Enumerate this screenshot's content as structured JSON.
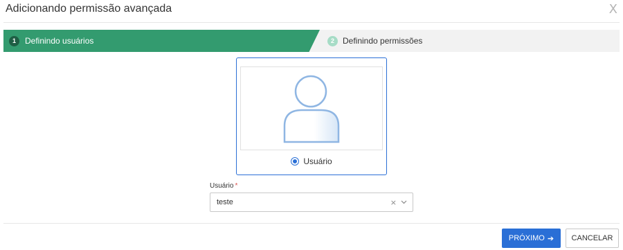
{
  "dialog": {
    "title": "Adicionando permissão avançada",
    "close_label": "X"
  },
  "stepper": {
    "steps": [
      {
        "number": "1",
        "label": "Definindo usuários",
        "state": "active"
      },
      {
        "number": "2",
        "label": "Definindo permissões",
        "state": "pending"
      }
    ]
  },
  "user_option": {
    "label": "Usuário",
    "selected": true,
    "icon": "user-avatar-icon"
  },
  "form": {
    "user_field": {
      "label": "Usuário",
      "required_mark": "*",
      "value": "teste",
      "clear_label": "×"
    }
  },
  "actions": {
    "next_label": "PRÓXIMO",
    "next_arrow": "➔",
    "cancel_label": "CANCELAR"
  },
  "colors": {
    "step_active": "#339b6f",
    "step_active_number": "#1e5e44",
    "step_pending_number": "#a6dcc6",
    "primary": "#2a6fd6",
    "required": "#d9534f"
  }
}
